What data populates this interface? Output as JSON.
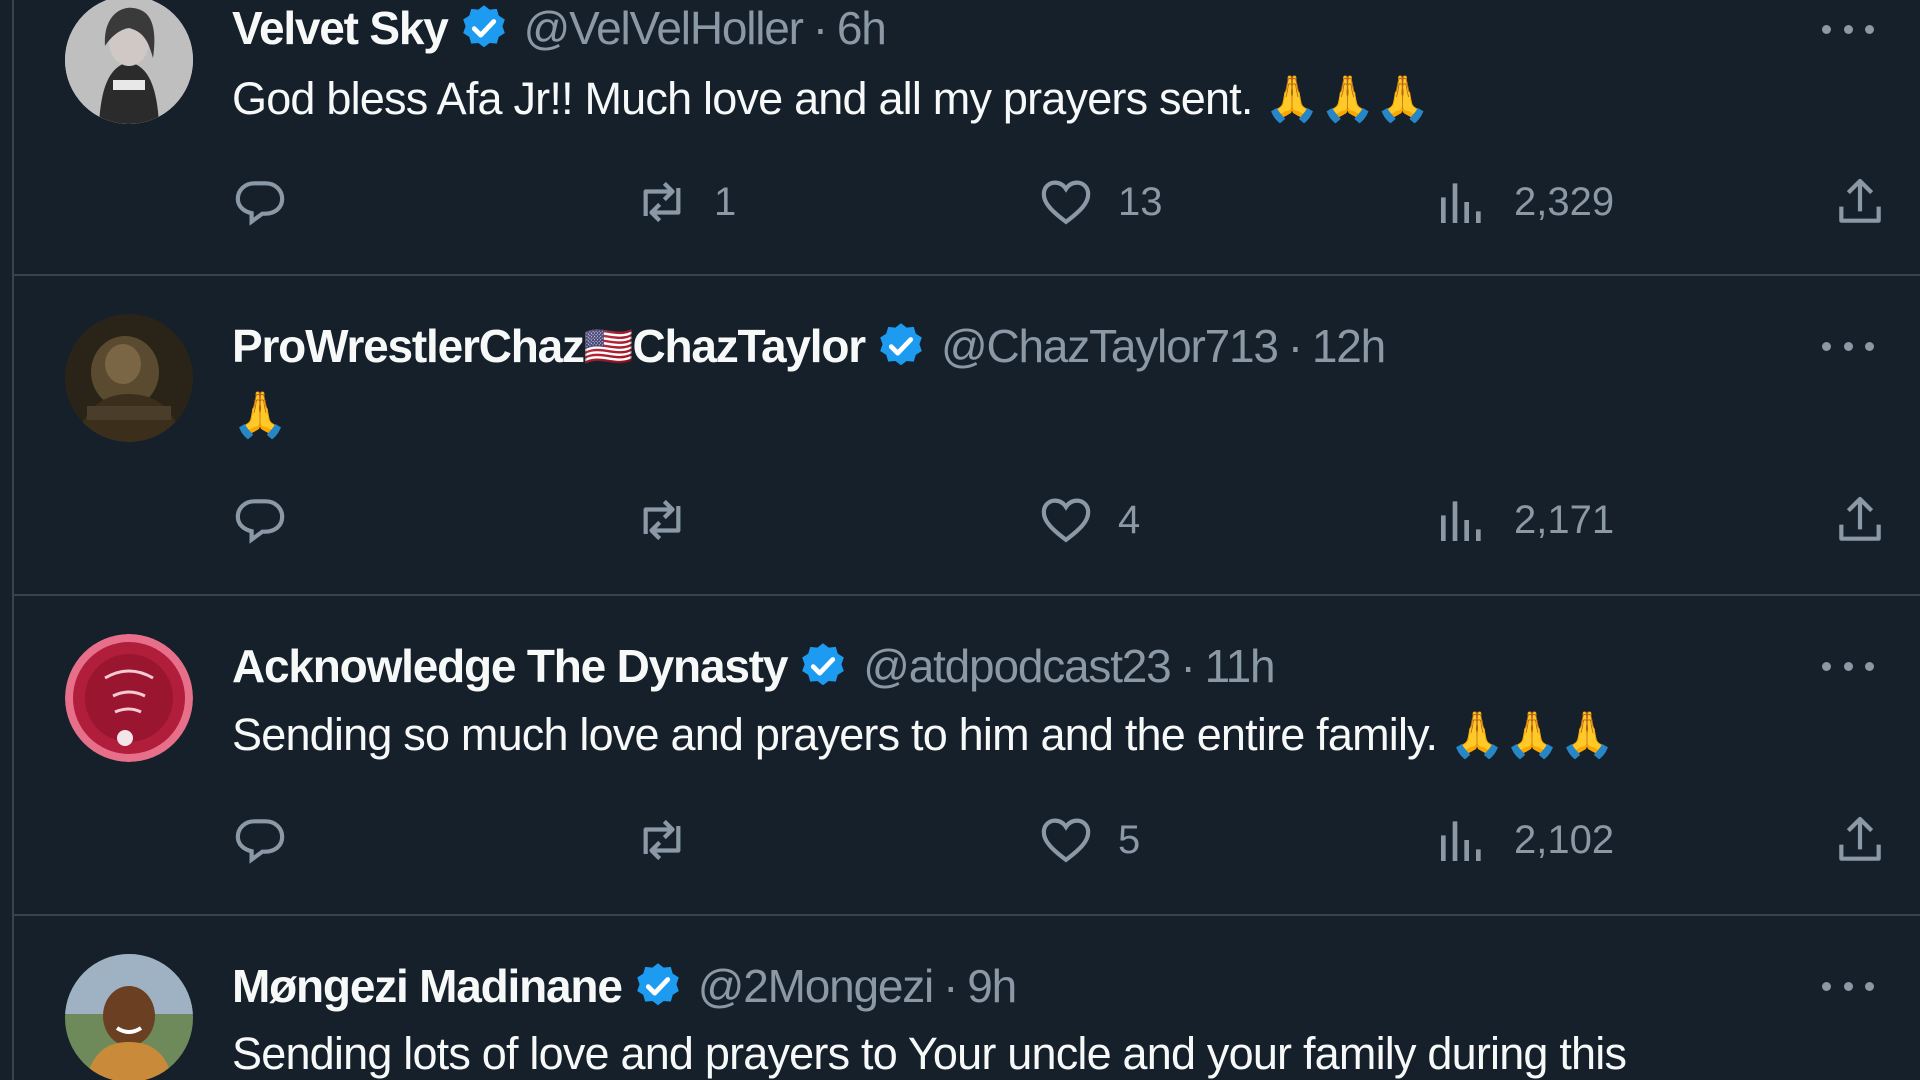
{
  "tweets": [
    {
      "name": "Velvet Sky",
      "handle": "@VelVelHoller",
      "separator": "·",
      "time": "6h",
      "text": "God bless Afa Jr!! Much love and all my prayers sent. 🙏🙏🙏",
      "replies": "",
      "retweets": "1",
      "likes": "13",
      "views": "2,329"
    },
    {
      "name": "ProWrestlerChaz",
      "flag": "🇺🇸",
      "name_suffix": "ChazTaylor",
      "handle": "@ChazTaylor713",
      "separator": "·",
      "time": "12h",
      "text": "🙏",
      "replies": "",
      "retweets": "",
      "likes": "4",
      "views": "2,171"
    },
    {
      "name": "Acknowledge The Dynasty",
      "handle": "@atdpodcast23",
      "separator": "·",
      "time": "11h",
      "text": "Sending so much love and prayers to him and the entire family. 🙏🙏🙏",
      "replies": "",
      "retweets": "",
      "likes": "5",
      "views": "2,102"
    },
    {
      "name": "Møngezi Madinane",
      "handle": "@2Mongezi",
      "separator": "·",
      "time": "9h",
      "text": "Sending lots of love and prayers to Your uncle and your family during this"
    }
  ],
  "icons": {
    "reply": "speech-bubble-icon",
    "retweet": "retweet-arrows-icon",
    "like": "heart-icon",
    "views": "bar-chart-icon",
    "share": "share-upload-icon",
    "verified": "verified-badge-icon",
    "more": "ellipsis-icon"
  },
  "colors": {
    "background": "#15202b",
    "divider": "#38444d",
    "secondary_text": "#8b98a5",
    "primary_text": "#f7f9f9",
    "verified_blue": "#1d9bf0"
  }
}
